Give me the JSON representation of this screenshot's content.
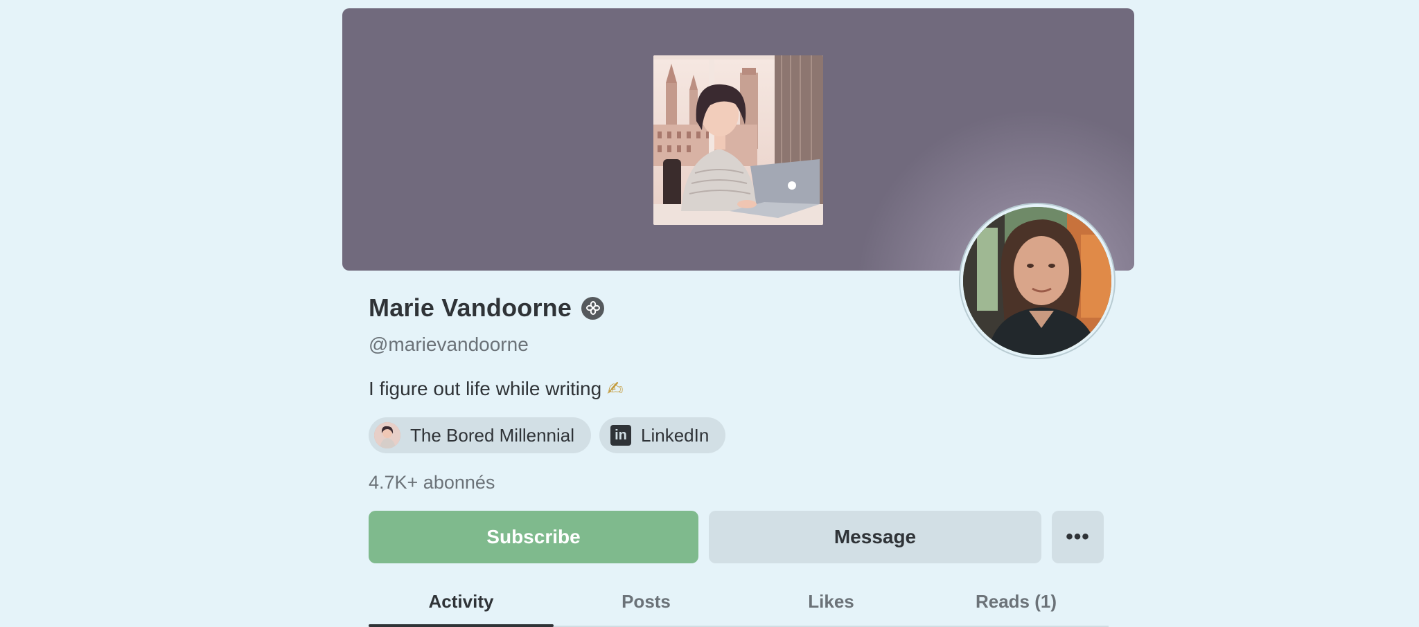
{
  "profile": {
    "name": "Marie Vandoorne",
    "handle": "@marievandoorne",
    "bio": "I figure out life while writing",
    "bio_emoji": "✍",
    "subscribers": "4.7K+ abonnés"
  },
  "links": [
    {
      "label": "The Bored Millennial",
      "icon": "publication-avatar-icon"
    },
    {
      "label": "LinkedIn",
      "icon": "linkedin-icon",
      "icon_glyph": "in"
    }
  ],
  "actions": {
    "subscribe_label": "Subscribe",
    "message_label": "Message",
    "more_label": "•••"
  },
  "tabs": [
    {
      "label": "Activity",
      "active": true
    },
    {
      "label": "Posts",
      "active": false
    },
    {
      "label": "Likes",
      "active": false
    },
    {
      "label": "Reads (1)",
      "active": false
    }
  ],
  "colors": {
    "background": "#e5f3f9",
    "banner": "#716a7d",
    "subscribe": "#7fba8d",
    "secondary_button": "#d2dfe5",
    "text": "#2f3337",
    "muted_text": "#6b7278"
  }
}
